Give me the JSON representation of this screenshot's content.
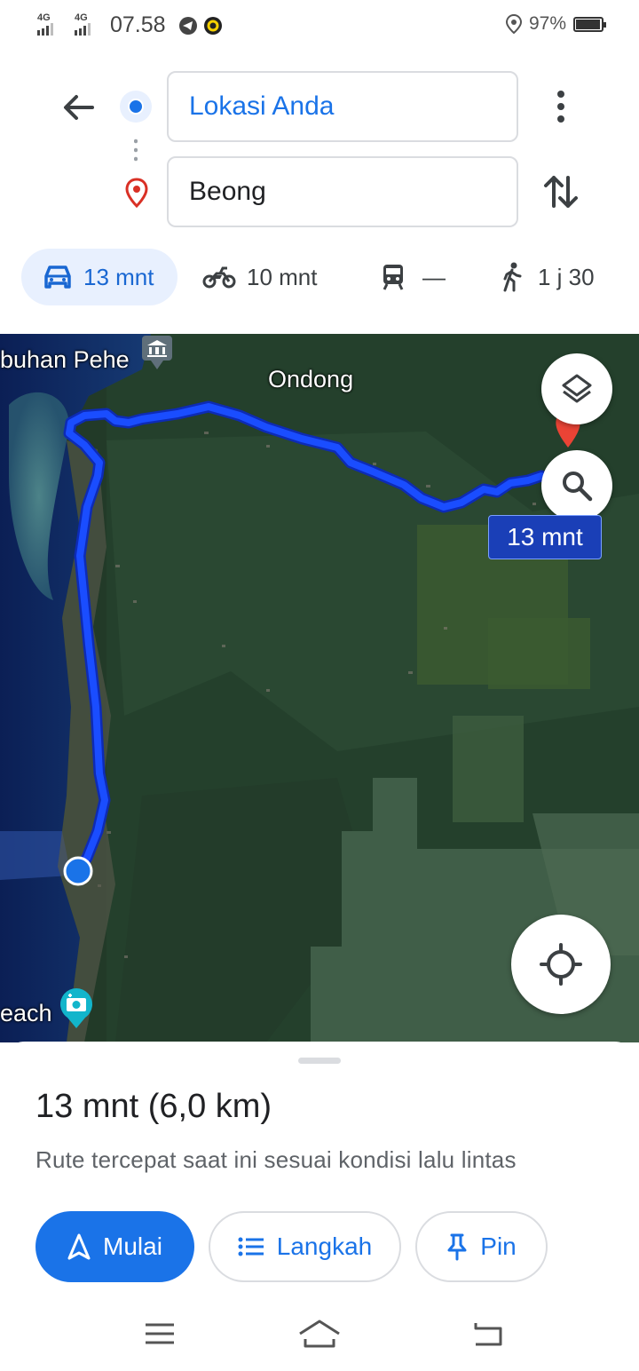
{
  "status_bar": {
    "network_1": "4G",
    "network_2": "4G",
    "time": "07.58",
    "battery": "97%",
    "battery_level": 0.97,
    "icons": [
      "signal-icon",
      "signal-icon",
      "telegram-icon",
      "notification-app-icon",
      "location-icon",
      "battery-icon"
    ]
  },
  "directions": {
    "origin_value": "Lokasi Anda",
    "destination_value": "Beong"
  },
  "modes": [
    {
      "name": "car",
      "label": "13 mnt",
      "active": true,
      "icon": "car-icon"
    },
    {
      "name": "motorcycle",
      "label": "10 mnt",
      "active": false,
      "icon": "motorcycle-icon"
    },
    {
      "name": "transit",
      "label": "—",
      "active": false,
      "icon": "train-icon"
    },
    {
      "name": "walk",
      "label": "1 j 30",
      "active": false,
      "icon": "walking-icon"
    }
  ],
  "map": {
    "labels": {
      "top_left": "buhan Pehe",
      "ondong": "Ondong",
      "beach": "each"
    },
    "route_time": "13 mnt",
    "route_color": "#1a4dff",
    "icons": [
      "layers-icon",
      "search-icon",
      "my-location-icon",
      "museum-icon",
      "camera-icon",
      "destination-pin-icon"
    ]
  },
  "sheet": {
    "summary": "13 mnt (6,0 km)",
    "subtitle": "Rute tercepat saat ini sesuai kondisi lalu lintas",
    "buttons": {
      "start": "Mulai",
      "steps": "Langkah",
      "pin": "Pin"
    }
  },
  "colors": {
    "accent": "#1a73e8",
    "destination_pin": "#d93025",
    "mode_active_bg": "#e8f0fe"
  }
}
